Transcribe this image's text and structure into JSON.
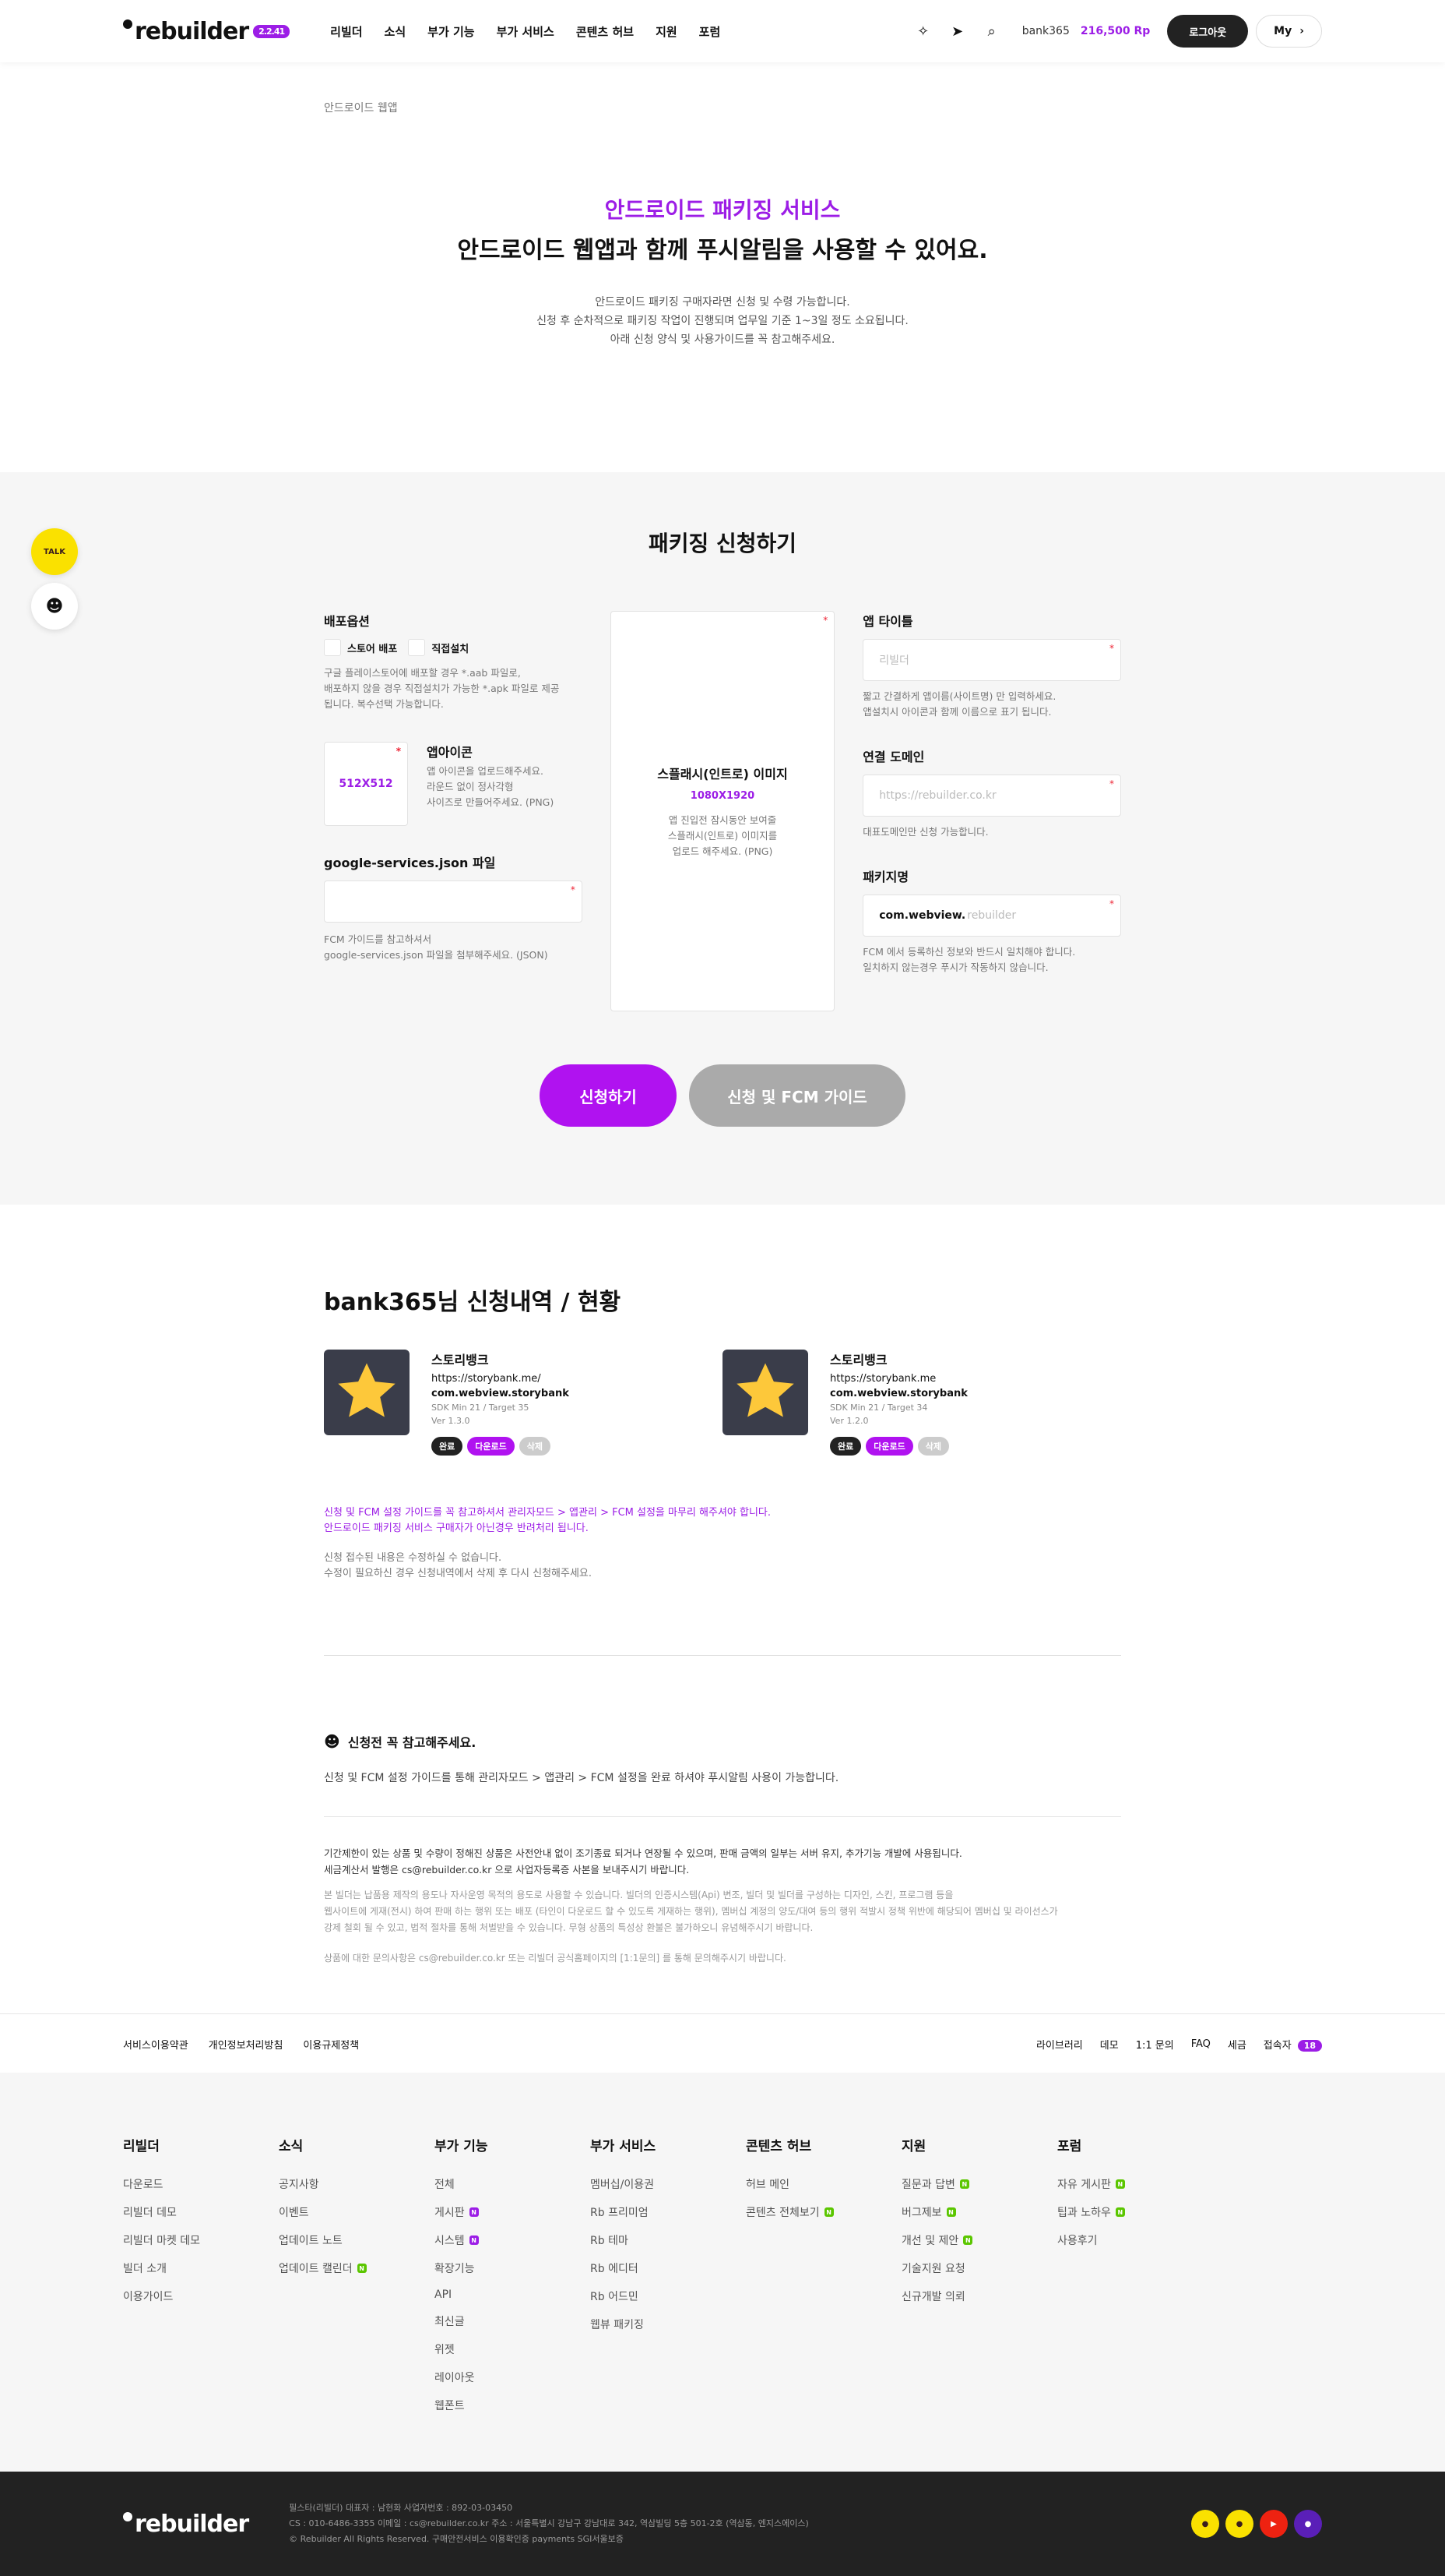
{
  "header": {
    "logo": "rebuilder",
    "version": "2.2.41",
    "nav": [
      "리빌더",
      "소식",
      "부가 기능",
      "부가 서비스",
      "콘텐츠 허브",
      "지원",
      "포럼"
    ],
    "user": "bank365",
    "points": "216,500 Rp",
    "logout": "로그아웃",
    "my": "My"
  },
  "breadcrumb": "안드로이드 웹앱",
  "intro": {
    "title": "안드로이드 패키징 서비스",
    "subtitle": "안드로이드 웹앱과 함께 푸시알림을 사용할 수 있어요.",
    "desc": [
      "안드로이드 패키징 구매자라면 신청 및 수령 가능합니다.",
      "신청 후 순차적으로 패키징 작업이 진행되며 업무일 기준 1~3일 정도 소요됩니다.",
      "아래 신청 양식 및 사용가이드를 꼭 참고해주세요."
    ]
  },
  "form": {
    "title": "패키징 신청하기",
    "deploy": {
      "label": "배포옵션",
      "opt1": "스토어 배포",
      "opt2": "직접설치",
      "help": [
        "구글 플레이스토어에 배포할 경우 *.aab 파일로,",
        "배포하지 않을 경우 직접설치가 가능한 *.apk 파일로 제공",
        "됩니다. 복수선택 가능합니다."
      ]
    },
    "icon": {
      "size": "512X512",
      "label": "앱아이콘",
      "help": [
        "앱 아이콘을 업로드해주세요.",
        "라운드 없이 정사각형",
        "사이즈로 만들어주세요. (PNG)"
      ]
    },
    "gs": {
      "label": "google-services.json 파일",
      "help": [
        "FCM 가이드를 참고하셔서",
        "google-services.json 파일을 첨부해주세요. (JSON)"
      ]
    },
    "splash": {
      "label": "스플래시(인트로) 이미지",
      "size": "1080X1920",
      "help": [
        "앱 진입전 잠시동안 보여줄",
        "스플래시(인트로) 이미지를",
        "업로드 해주세요. (PNG)"
      ]
    },
    "apptitle": {
      "label": "앱 타이틀",
      "placeholder": "리빌더",
      "help": [
        "짧고 간결하게 앱이름(사이트명) 만 입력하세요.",
        "앱설치시 아이콘과 함께 이름으로 표기 됩니다."
      ]
    },
    "domain": {
      "label": "연결 도메인",
      "placeholder": "https://rebuilder.co.kr",
      "help": [
        "대표도메인만 신청 가능합니다."
      ]
    },
    "pkg": {
      "label": "패키지명",
      "prefix": "com.webview.",
      "placeholder": "rebuilder",
      "help": [
        "FCM 에서 등록하신 정보와 반드시 일치해야 합니다.",
        "일치하지 않는경우 푸시가 작동하지 않습니다."
      ]
    },
    "submit": "신청하기",
    "guide": "신청 및 FCM 가이드"
  },
  "status": {
    "title": "bank365님 신청내역 / 현황",
    "cards": [
      {
        "name": "스토리뱅크",
        "url": "https://storybank.me/",
        "pkg": "com.webview.storybank",
        "sdk": "SDK Min 21 / Target 35",
        "ver": "Ver 1.3.0",
        "t1": "완료",
        "t2": "다운로드",
        "t3": "삭제"
      },
      {
        "name": "스토리뱅크",
        "url": "https://storybank.me",
        "pkg": "com.webview.storybank",
        "sdk": "SDK Min 21 / Target 34",
        "ver": "Ver 1.2.0",
        "t1": "완료",
        "t2": "다운로드",
        "t3": "삭제"
      }
    ],
    "notes": [
      "신청 및 FCM 설정 가이드를 꼭 참고하셔서 관리자모드 > 앱관리 > FCM 설정을 마무리 해주셔야 합니다.",
      "안드로이드 패키징 서비스 구매자가 아닌경우 반려처리 됩니다.",
      "신청 접수된 내용은 수정하실 수 없습니다.",
      "수정이 필요하신 경우 신청내역에서 삭제 후 다시 신청해주세요."
    ]
  },
  "notice": {
    "title": "신청전 꼭 참고해주세요.",
    "text": "신청 및 FCM 설정 가이드를 통해 관리자모드 > 앱관리 > FCM 설정을 완료 하셔야 푸시알림 사용이 가능합니다.",
    "legal": [
      "기간제한이 있는 상품 및 수량이 정해진 상품은 사전안내 없이 조기종료 되거나 연장될 수 있으며, 판매 금액의 일부는 서버 유지, 추가기능 개발에 사용됩니다.",
      "세금계산서 발행은 cs@rebuilder.co.kr 으로 사업자등록증 사본을 보내주시기 바랍니다."
    ],
    "legal2": [
      "본 빌더는 납품용 제작의 용도나 자사운영 목적의 용도로 사용할 수 있습니다. 빌더의 인증시스템(Api) 변조, 빌더 및 빌더를 구성하는 디자인, 스킨, 프로그램 등을",
      "웹사이트에 게재(전시) 하여 판매 하는 행위 또는 배포 (타인이 다운로드 할 수 있도록 게재하는 행위), 멤버십 계정의 양도/대여 등의 행위 적발시 정책 위반에 해당되어 멤버십 및 라이선스가",
      "강제 철회 될 수 있고, 법적 절차를 통해 처벌받을 수 있습니다. 무형 상품의 특성상 환불은 불가하오니 유념해주시기 바랍니다."
    ],
    "legal3": "상품에 대한 문의사항은 cs@rebuilder.co.kr 또는 리빌더 공식홈페이지의 [1:1문의] 를 통해 문의해주시기 바랍니다."
  },
  "footer": {
    "links": [
      "서비스이용약관",
      "개인정보처리방침",
      "이용규제정책"
    ],
    "right": [
      "라이브러리",
      "데모",
      "1:1 문의",
      "FAQ",
      "세금",
      "접속자"
    ],
    "visitors": "18",
    "cols": [
      {
        "h": "리빌더",
        "items": [
          "다운로드",
          "리빌더 데모",
          "리빌더 마켓 데모",
          "빌더 소개",
          "이용가이드"
        ]
      },
      {
        "h": "소식",
        "items": [
          "공지사항",
          "이벤트",
          "업데이트 노트",
          "업데이트 캘린더"
        ]
      },
      {
        "h": "부가 기능",
        "items": [
          "전체",
          "게시판",
          "시스템",
          "확장기능",
          "API",
          "최신글",
          "위젯",
          "레이아웃",
          "웹폰트"
        ]
      },
      {
        "h": "부가 서비스",
        "items": [
          "멤버십/이용권",
          "Rb 프리미엄",
          "Rb 테마",
          "Rb 에디터",
          "Rb 어드민",
          "웹뷰 패키징"
        ]
      },
      {
        "h": "콘텐츠 허브",
        "items": [
          "허브 메인",
          "콘텐츠 전체보기"
        ]
      },
      {
        "h": "지원",
        "items": [
          "질문과 답변",
          "버그제보",
          "개선 및 제안",
          "기술지원 요청",
          "신규개발 의뢰"
        ]
      },
      {
        "h": "포럼",
        "items": [
          "자유 게시판",
          "팁과 노하우",
          "사용후기"
        ]
      }
    ],
    "info": [
      "필스타(리빌더)    대표자 : 남현화    사업자번호 : 892-03-03450",
      "CS : 010-6486-3355    이메일 : cs@rebuilder.co.kr    주소 : 서울특별시 강남구 강남대로 342, 역삼빌딩 5층 501-2호 (역삼동, 엔지스에이스)",
      "© Rebuilder All Rights Reserved.      구매안전서비스 이용확인증      payments      SGI서울보증"
    ]
  },
  "side": {
    "talk": "TALK"
  },
  "colors": {
    "accent": "#9c1de6",
    "button": "#b012f0"
  }
}
